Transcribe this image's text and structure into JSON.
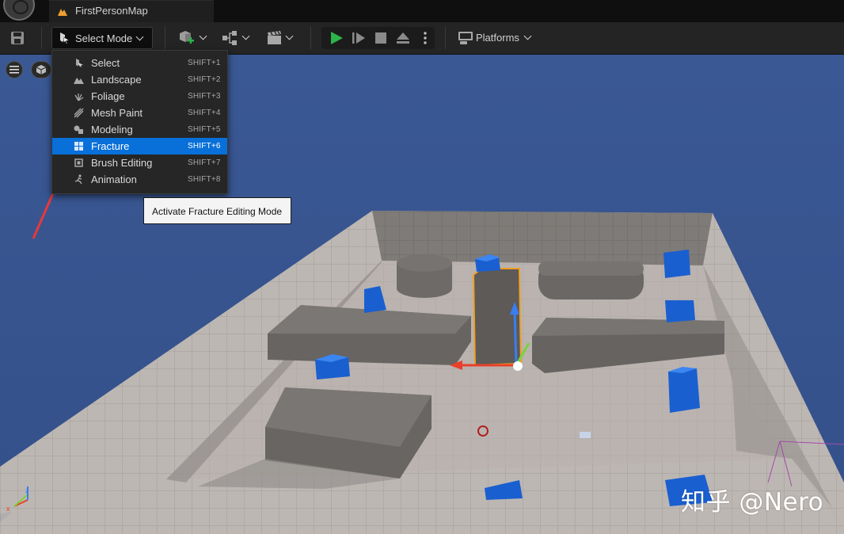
{
  "titlebar": {
    "tab_title": "FirstPersonMap"
  },
  "toolbar": {
    "mode_label": "Select Mode",
    "platforms_label": "Platforms"
  },
  "mode_menu": {
    "items": [
      {
        "label": "Select",
        "shortcut": "SHIFT+1",
        "icon": "select-mode-icon"
      },
      {
        "label": "Landscape",
        "shortcut": "SHIFT+2",
        "icon": "landscape-icon"
      },
      {
        "label": "Foliage",
        "shortcut": "SHIFT+3",
        "icon": "foliage-icon"
      },
      {
        "label": "Mesh Paint",
        "shortcut": "SHIFT+4",
        "icon": "mesh-paint-icon"
      },
      {
        "label": "Modeling",
        "shortcut": "SHIFT+5",
        "icon": "modeling-icon"
      },
      {
        "label": "Fracture",
        "shortcut": "SHIFT+6",
        "icon": "fracture-icon",
        "highlighted": true
      },
      {
        "label": "Brush Editing",
        "shortcut": "SHIFT+7",
        "icon": "brush-editing-icon"
      },
      {
        "label": "Animation",
        "shortcut": "SHIFT+8",
        "icon": "animation-icon"
      }
    ]
  },
  "tooltip": {
    "text": "Activate Fracture Editing Mode"
  },
  "watermark": {
    "text": "知乎 @Nero"
  },
  "colors": {
    "highlight": "#0870d8",
    "play_green": "#2cb34a",
    "viewport_sky": "#3c5a95",
    "annotation_arrow": "#e8383b",
    "selection_outline": "#f0a020"
  }
}
